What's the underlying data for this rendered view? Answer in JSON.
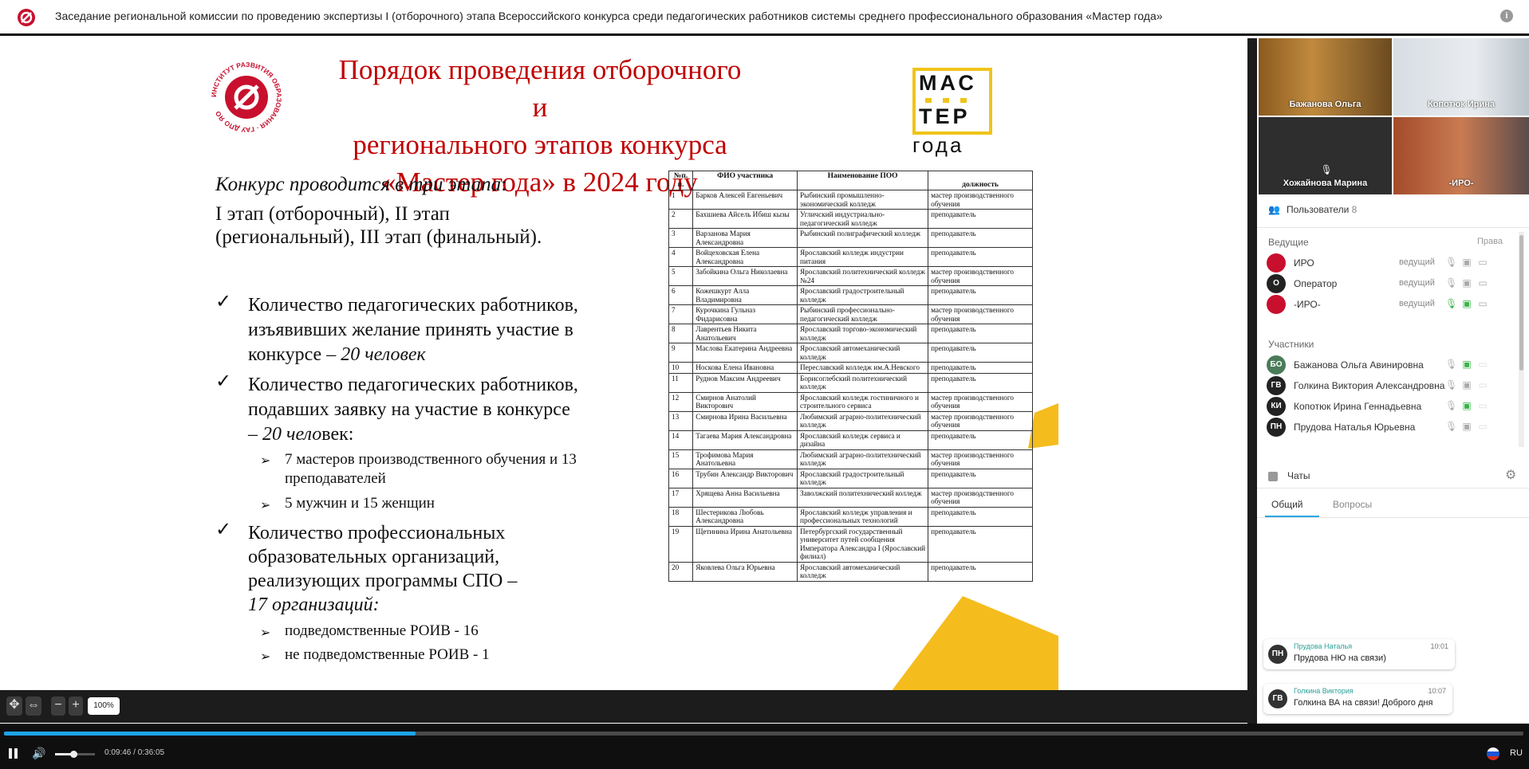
{
  "window": {
    "title": "Заседание региональной комиссии по проведению экспертизы I (отборочного) этапа Всероссийского конкурса среди педагогических работников системы среднего профессионального образования «Мастер года»",
    "info_icon": "info-icon"
  },
  "slide": {
    "title_lines": [
      "Порядок проведения отборочного и",
      "регионального этапов конкурса",
      "«Мастер года» в 2024 году"
    ],
    "logo_left_text": "ИНСТИТУТ РАЗВИТИЯ ОБРАЗОВАНИЯ · ГАУ ДПО ЯО",
    "logo_right": {
      "line1": "МАС",
      "line2": "ТЕР",
      "line3": "года"
    },
    "intro_italic": "Конкурс проводится в три этапа",
    "intro_colon": ":",
    "stages_line1": "I этап (отборочный), II этап",
    "stages_line2": "(региональный), III этап (финальный).",
    "point1_lines": [
      "Количество педагогических работников,",
      "изъявивших желание принять участие в",
      "конкурсе – "
    ],
    "point1_italic": "20 человек",
    "point2_lines": [
      "Количество педагогических работников,",
      "подавших заявку на участие в конкурсе",
      "– "
    ],
    "point2_italic": "20 чело",
    "point2_end": "век:",
    "sub2a_lines": [
      "7 мастеров производственного обучения и 13",
      "преподавателей"
    ],
    "sub2b": "5 мужчин и 15 женщин",
    "point3_lines": [
      "Количество профессиональных",
      "образовательных организаций,",
      "реализующих программы СПО –"
    ],
    "point3_italic": "17 организаций:",
    "sub3a": "подведомственные РОИВ - 16",
    "sub3b": "не подведомственные РОИВ - 1",
    "table": {
      "headers": [
        "№п. п.",
        "ФИО участника",
        "Наименование ПОО",
        "должность"
      ],
      "rows": [
        [
          "1",
          "Барков Алексей Евгеньевич",
          "Рыбинский промышленно-экономический колледж",
          "мастер производственного обучения"
        ],
        [
          "2",
          "Бахшиева Айсель Ибиш кызы",
          "Угличский индустриально-педагогический колледж",
          "преподаватель"
        ],
        [
          "3",
          "Варзанова Мария Александровна",
          "Рыбинский полиграфический колледж",
          "преподаватель"
        ],
        [
          "4",
          "Войцеховская Елена Александровна",
          "Ярославский колледж индустрии питания",
          "преподаватель"
        ],
        [
          "5",
          "Забойкина Ольга Николаевна",
          "Ярославский политехнический колледж №24",
          "мастер производственного обучения"
        ],
        [
          "6",
          "Кожешкурт Алла Владимировна",
          "Ярославский градостроительный колледж",
          "преподаватель"
        ],
        [
          "7",
          "Курочкина Гульназ Фидарисовна",
          "Рыбинский профессионально-педагогический колледж",
          "мастер производственного обучения"
        ],
        [
          "8",
          "Лаврентьев Никита Анатольевич",
          "Ярославский торгово-экономический колледж",
          "преподаватель"
        ],
        [
          "9",
          "Маслова Екатерина Андреевна",
          "Ярославский автомеханический колледж",
          "преподаватель"
        ],
        [
          "10",
          "Носкова Елена Ивановна",
          "Переславский колледж им.А.Невского",
          "преподаватель"
        ],
        [
          "11",
          "Руднов Максим Андреевич",
          "Борисоглебский политехнический колледж",
          "преподаватель"
        ],
        [
          "12",
          "Смирнов Анатолий Викторович",
          "Ярославский колледж гостиничного и строительного сервиса",
          "мастер производственного обучения"
        ],
        [
          "13",
          "Смирнова Ирина Васильевна",
          "Любимский аграрно-политехнический колледж",
          "мастер производственного обучения"
        ],
        [
          "14",
          "Тагаева Мария Александровна",
          "Ярославский колледж сервиса и дизайна",
          "преподаватель"
        ],
        [
          "15",
          "Трофимова Мария Анатольевна",
          "Любимский аграрно-политехнический колледж",
          "мастер производственного обучения"
        ],
        [
          "16",
          "Трубин Александр Викторович",
          "Ярославский градостроительный колледж",
          "преподаватель"
        ],
        [
          "17",
          "Хрящева Анна Васильевна",
          "Заволжский политехнический колледж",
          "мастер производственного обучения"
        ],
        [
          "18",
          "Шестерикова Любовь Александровна",
          "Ярославский колледж управления и профессиональных технологий",
          "преподаватель"
        ],
        [
          "19",
          "Щетинина Ирина Анатольевна",
          "Петербургский государственный университет путей сообщения Императора Александра I (Ярославский филиал)",
          "преподаватель"
        ],
        [
          "20",
          "Яковлева Ольга Юрьевна",
          "Ярославский автомеханический колледж",
          "преподаватель"
        ]
      ]
    }
  },
  "controls": {
    "zoom": "100%"
  },
  "videos": [
    {
      "name": "Бажанова Ольга"
    },
    {
      "name": "Копотюк Ирина"
    },
    {
      "name": "Хожайнова Марина"
    },
    {
      "name": "-ИРО-"
    }
  ],
  "users": {
    "title": "Пользователи",
    "count": "8",
    "hosts_label": "Ведущие",
    "rights_label": "Права",
    "participants_label": "Участники",
    "hosts": [
      {
        "initials": "",
        "name": "ИРО",
        "role": "ведущий"
      },
      {
        "initials": "О",
        "name": "Оператор",
        "role": "ведущий"
      },
      {
        "initials": "",
        "name": "-ИРО-",
        "role": "ведущий"
      }
    ],
    "participants": [
      {
        "initials": "БО",
        "name": "Бажанова Ольга Авинировна"
      },
      {
        "initials": "ГВ",
        "name": "Голкина Виктория Александровна"
      },
      {
        "initials": "КИ",
        "name": "Копотюк Ирина Геннадьевна"
      },
      {
        "initials": "ПН",
        "name": "Прудова Наталья Юрьевна"
      }
    ],
    "colors": {
      "participant_avatar": "#4a7c59",
      "host_avatar": "#222222",
      "mic_on": "#3cb44b"
    }
  },
  "chats": {
    "title": "Чаты",
    "tab_general": "Общий",
    "tab_questions": "Вопросы",
    "messages": [
      {
        "initials": "ПН",
        "author": "Прудова Наталья",
        "time": "10:01",
        "text": "Прудова НЮ на связи)"
      },
      {
        "initials": "ГВ",
        "author": "Голкина Виктория",
        "time": "10:07",
        "text": "Голкина ВА на связи! Доброго дня"
      }
    ]
  },
  "player": {
    "time": "0:09:46 / 0:36:05",
    "progress": 0.271,
    "volume": 0.45,
    "lang": "RU",
    "accent": "#1ea4e8"
  }
}
